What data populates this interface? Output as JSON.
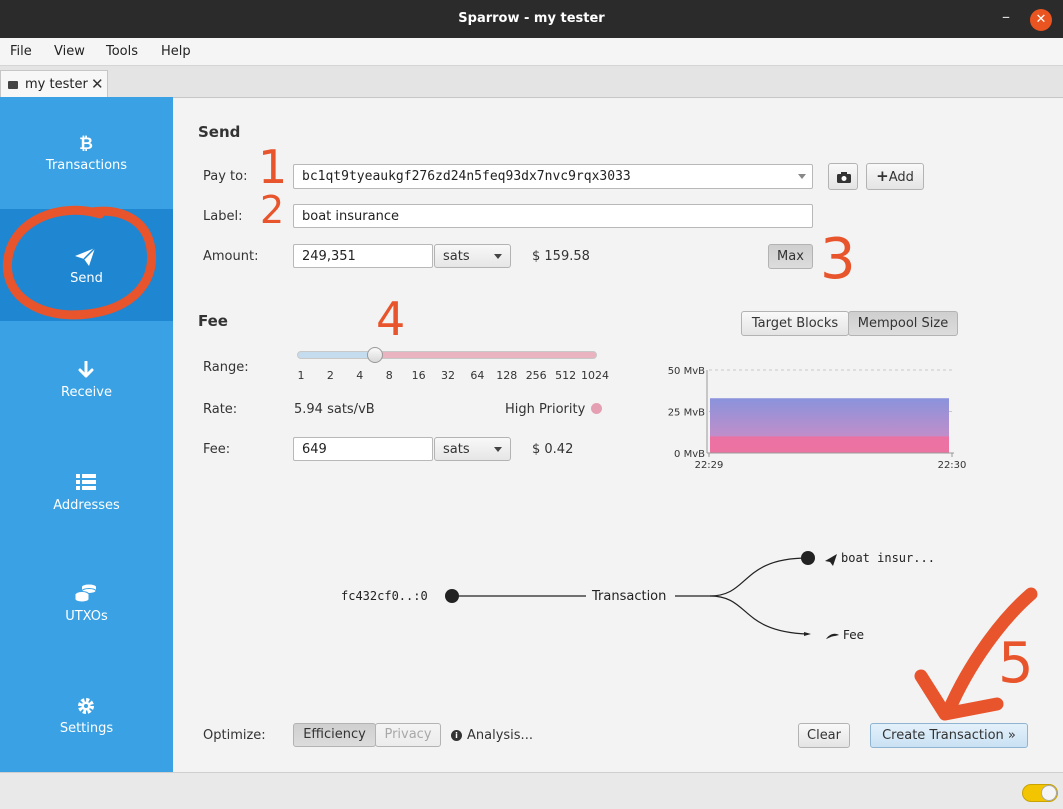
{
  "window": {
    "title": "Sparrow - my tester",
    "minimize": "–",
    "close": "✕"
  },
  "menu": [
    "File",
    "View",
    "Tools",
    "Help"
  ],
  "tab": {
    "label": "my tester",
    "close": "✕"
  },
  "sidebar": {
    "items": [
      {
        "label": "Transactions",
        "icon": "bitcoin-icon"
      },
      {
        "label": "Send",
        "icon": "paper-plane-icon",
        "active": true
      },
      {
        "label": "Receive",
        "icon": "arrow-down-icon"
      },
      {
        "label": "Addresses",
        "icon": "list-icon"
      },
      {
        "label": "UTXOs",
        "icon": "coins-icon"
      },
      {
        "label": "Settings",
        "icon": "gear-icon"
      }
    ]
  },
  "send": {
    "heading": "Send",
    "pay_to_label": "Pay to:",
    "pay_to_value": "bc1qt9tyeaukgf276zd24n5feq93dx7nvc9rqx3033",
    "add_button": "Add",
    "label_label": "Label:",
    "label_value": "boat insurance",
    "amount_label": "Amount:",
    "amount_value": "249,351",
    "amount_unit": "sats",
    "amount_fiat": "$ 159.58",
    "max_button": "Max"
  },
  "fee": {
    "heading": "Fee",
    "range_label": "Range:",
    "range_ticks": [
      "1",
      "2",
      "4",
      "8",
      "16",
      "32",
      "64",
      "128",
      "256",
      "512",
      "1024"
    ],
    "slider_position": 0.26,
    "rate_label": "Rate:",
    "rate_value": "5.94 sats/vB",
    "priority_label": "High Priority",
    "fee_label": "Fee:",
    "fee_value": "649",
    "fee_unit": "sats",
    "fee_fiat": "$ 0.42",
    "toggle": {
      "target_blocks": "Target Blocks",
      "mempool_size": "Mempool Size",
      "selected": "Mempool Size"
    }
  },
  "chart_data": {
    "type": "area",
    "x": [
      "22:29",
      "22:30"
    ],
    "ytick_labels": [
      "50 MvB",
      "25 MvB",
      "0 MvB"
    ],
    "ylim": [
      0,
      50
    ],
    "series": [
      {
        "values": [
          10,
          10
        ],
        "color": "#ee6f9d"
      },
      {
        "values": [
          33,
          33
        ],
        "color": "#9b8ed8"
      }
    ],
    "grid": true
  },
  "diagram": {
    "input": "fc432cf0..:0",
    "center": "Transaction",
    "output_payment": "boat insur...",
    "output_fee": "Fee"
  },
  "footer": {
    "optimize_label": "Optimize:",
    "efficiency": "Efficiency",
    "privacy": "Privacy",
    "analysis": "Analysis...",
    "clear_button": "Clear",
    "create_button": "Create Transaction »"
  },
  "annotations": [
    "1",
    "2",
    "3",
    "4",
    "5"
  ],
  "colors": {
    "sidebar": "#3aa2e4",
    "sidebar_active": "#1f86d1",
    "annotation": "#e8542b",
    "priority_dot": "#e4a0b2"
  }
}
